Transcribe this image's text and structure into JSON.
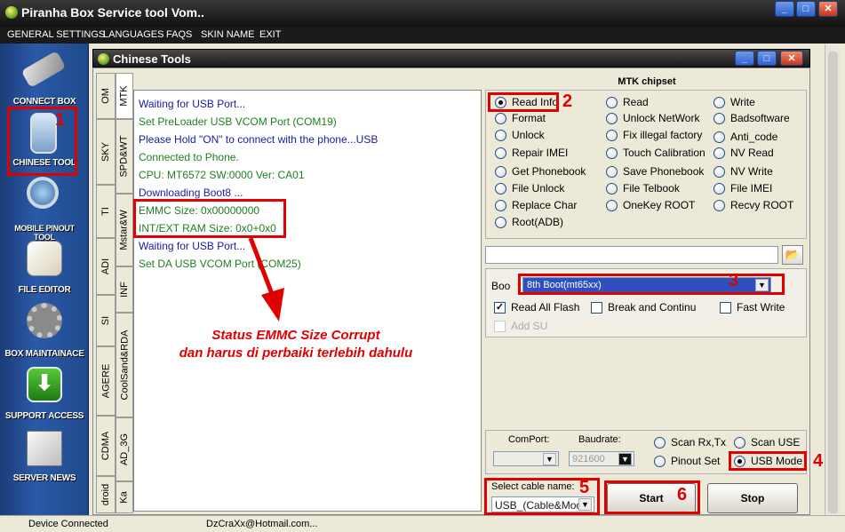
{
  "window": {
    "title": "Piranha Box Service tool Vom..",
    "minimize": "_",
    "maximize": "□",
    "close": "✕"
  },
  "menu": [
    "GENERAL SETTINGS",
    "LANGUAGES",
    "FAQS",
    "SKIN NAME",
    "EXIT"
  ],
  "sidebar": [
    {
      "label": "CONNECT BOX",
      "icon": "usb-icon"
    },
    {
      "label": "CHINESE TOOL",
      "icon": "phone-icon"
    },
    {
      "label": "MOBILE PINOUT TOOL",
      "icon": "magnifier-icon"
    },
    {
      "label": "FILE EDITOR",
      "icon": "editor-icon"
    },
    {
      "label": "BOX MAINTAINACE",
      "icon": "gears-icon"
    },
    {
      "label": "SUPPORT ACCESS",
      "icon": "download-icon"
    },
    {
      "label": "SERVER NEWS",
      "icon": "newspaper-icon"
    }
  ],
  "inner_window": {
    "title": "Chinese Tools"
  },
  "tabs_col1": [
    "OM",
    "SKY",
    "TI",
    "ADI",
    "SI",
    "AGERE",
    "CDMA",
    "droid"
  ],
  "tabs_col2": [
    "MTK",
    "SPD&WT",
    "Mstar&W",
    "INF",
    "CoolSand&RDA",
    "AD_3G",
    "Ka"
  ],
  "log": [
    {
      "text": "Waiting for USB Port...",
      "color": "blue"
    },
    {
      "text": "Set PreLoader USB VCOM Port (COM19)",
      "color": "green"
    },
    {
      "text": "Please Hold \"ON\" to connect with the phone...USB",
      "color": "blue"
    },
    {
      "text": "Connected to Phone.",
      "color": "green"
    },
    {
      "text": "CPU: MT6572 SW:0000 Ver: CA01",
      "color": "green"
    },
    {
      "text": "Downloading Boot8 ...",
      "color": "blue"
    },
    {
      "text": "EMMC Size: 0x00000000",
      "color": "green"
    },
    {
      "text": "INT/EXT RAM  Size: 0x0+0x0",
      "color": "green"
    },
    {
      "text": "Waiting for USB Port...",
      "color": "blue"
    },
    {
      "text": "Set DA USB VCOM Port (COM25)",
      "color": "green"
    }
  ],
  "annotation": {
    "line1": "Status EMMC Size Corrupt",
    "line2": "dan harus di perbaiki terlebih dahulu",
    "markers": [
      "1",
      "2",
      "3",
      "4",
      "5",
      "6"
    ]
  },
  "mtk": {
    "header": "MTK chipset",
    "radios": [
      [
        "Read Info",
        "Format",
        "Unlock",
        "Repair IMEI",
        "Get Phonebook",
        "File Unlock",
        "Replace Char",
        "Root(ADB)"
      ],
      [
        "Read",
        "Unlock NetWork",
        "Fix illegal factory",
        "Touch Calibration",
        "Save Phonebook",
        "File Telbook",
        "OneKey ROOT"
      ],
      [
        "Write",
        "Badsoftware",
        "Anti_code",
        "NV  Read",
        "NV  Write",
        "File IMEI",
        "Recvy ROOT"
      ]
    ],
    "selected": "Read Info",
    "boot_label": "Boo",
    "boot_value": "8th Boot(mt65xx)",
    "read_all_flash": "Read All Flash",
    "break_continue": "Break and Continu",
    "fast_write": "Fast Write",
    "add_su": "Add SU",
    "comport_label": "ComPort:",
    "baudrate_label": "Baudrate:",
    "baudrate_value": "921600",
    "mode_radios": [
      "Scan Rx,Tx",
      "Scan USE",
      "Pinout Set",
      "USB Mode"
    ],
    "mode_selected": "USB Mode",
    "cable_label": "Select cable name:",
    "cable_value": "USB_(Cable&Moc",
    "start": "Start",
    "stop": "Stop"
  },
  "status": {
    "left": "Device Connected",
    "email": "DzCraXx@Hotmail.com..."
  }
}
